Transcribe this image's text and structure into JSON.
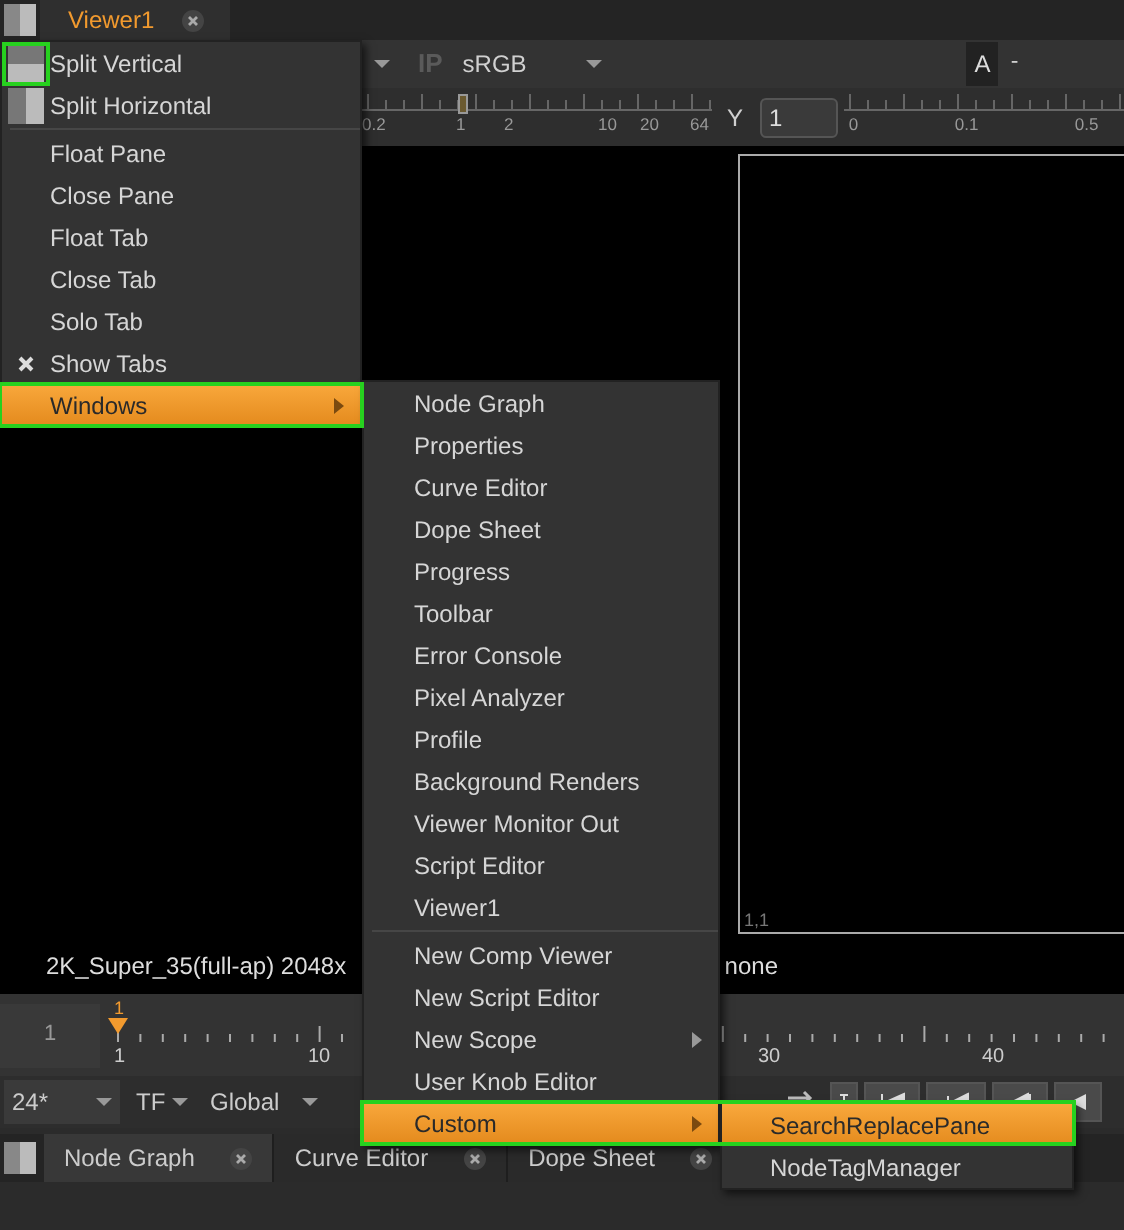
{
  "top_tabs": [
    {
      "label": "Viewer1",
      "selected": true
    }
  ],
  "viewer_toolbar": {
    "ip_button": {
      "label": "IP",
      "disabled": true
    },
    "colorspace": "sRGB",
    "input_label": "A",
    "input_value": "-"
  },
  "gain_ruler": {
    "labels": [
      "0.2",
      "1",
      "2",
      "10",
      "20",
      "64"
    ]
  },
  "gamma": {
    "label": "Y",
    "value": "1",
    "ruler_labels": [
      "0",
      "0.1",
      "0.5"
    ]
  },
  "viewer": {
    "corner_label": "1,1"
  },
  "info_bar": [
    "2K_Super_35(full-ap) 2048x",
    "none"
  ],
  "timeline": {
    "current_frame": "1",
    "marker_label": "1",
    "labels": [
      "1",
      "10",
      "30",
      "40"
    ]
  },
  "playback": {
    "fps": "24*",
    "time_format": "TF",
    "range": "Global"
  },
  "bottom_tabs": [
    {
      "label": "Node Graph",
      "selected": true
    },
    {
      "label": "Curve Editor",
      "selected": false
    },
    {
      "label": "Dope Sheet",
      "selected": false
    }
  ],
  "pane_menu": [
    {
      "label": "Split Vertical",
      "kind": "icon-split-v",
      "outlined": true,
      "highlighted": false,
      "checked": false,
      "submenu": false
    },
    {
      "label": "Split Horizontal",
      "kind": "icon-split-h",
      "outlined": false,
      "highlighted": false,
      "checked": false,
      "submenu": false
    },
    {
      "kind": "separator"
    },
    {
      "label": "Float Pane",
      "kind": "plain",
      "outlined": false,
      "highlighted": false,
      "checked": false,
      "submenu": false
    },
    {
      "label": "Close Pane",
      "kind": "plain",
      "outlined": false,
      "highlighted": false,
      "checked": false,
      "submenu": false
    },
    {
      "label": "Float Tab",
      "kind": "plain",
      "outlined": false,
      "highlighted": false,
      "checked": false,
      "submenu": false
    },
    {
      "label": "Close Tab",
      "kind": "plain",
      "outlined": false,
      "highlighted": false,
      "checked": false,
      "submenu": false
    },
    {
      "label": "Solo Tab",
      "kind": "plain",
      "outlined": false,
      "highlighted": false,
      "checked": false,
      "submenu": false
    },
    {
      "label": "Show Tabs",
      "kind": "plain",
      "outlined": false,
      "highlighted": false,
      "checked": true,
      "submenu": false
    },
    {
      "label": "Windows",
      "kind": "plain",
      "outlined": true,
      "highlighted": true,
      "checked": false,
      "submenu": true
    }
  ],
  "windows_menu": [
    {
      "label": "Node Graph",
      "kind": "plain",
      "highlighted": false,
      "outlined": false,
      "submenu": false
    },
    {
      "label": "Properties",
      "kind": "plain",
      "highlighted": false,
      "outlined": false,
      "submenu": false
    },
    {
      "label": "Curve Editor",
      "kind": "plain",
      "highlighted": false,
      "outlined": false,
      "submenu": false
    },
    {
      "label": "Dope Sheet",
      "kind": "plain",
      "highlighted": false,
      "outlined": false,
      "submenu": false
    },
    {
      "label": "Progress",
      "kind": "plain",
      "highlighted": false,
      "outlined": false,
      "submenu": false
    },
    {
      "label": "Toolbar",
      "kind": "plain",
      "highlighted": false,
      "outlined": false,
      "submenu": false
    },
    {
      "label": "Error Console",
      "kind": "plain",
      "highlighted": false,
      "outlined": false,
      "submenu": false
    },
    {
      "label": "Pixel Analyzer",
      "kind": "plain",
      "highlighted": false,
      "outlined": false,
      "submenu": false
    },
    {
      "label": "Profile",
      "kind": "plain",
      "highlighted": false,
      "outlined": false,
      "submenu": false
    },
    {
      "label": "Background Renders",
      "kind": "plain",
      "highlighted": false,
      "outlined": false,
      "submenu": false
    },
    {
      "label": "Viewer Monitor Out",
      "kind": "plain",
      "highlighted": false,
      "outlined": false,
      "submenu": false
    },
    {
      "label": "Script Editor",
      "kind": "plain",
      "highlighted": false,
      "outlined": false,
      "submenu": false
    },
    {
      "label": "Viewer1",
      "kind": "plain",
      "highlighted": false,
      "outlined": false,
      "submenu": false
    },
    {
      "kind": "separator"
    },
    {
      "label": "New Comp Viewer",
      "kind": "plain",
      "highlighted": false,
      "outlined": false,
      "submenu": false
    },
    {
      "label": "New Script Editor",
      "kind": "plain",
      "highlighted": false,
      "outlined": false,
      "submenu": false
    },
    {
      "label": "New Scope",
      "kind": "plain",
      "highlighted": false,
      "outlined": false,
      "submenu": true
    },
    {
      "label": "User Knob Editor",
      "kind": "plain",
      "highlighted": false,
      "outlined": false,
      "submenu": false
    },
    {
      "label": "Custom",
      "kind": "plain",
      "highlighted": true,
      "outlined": true,
      "submenu": true
    }
  ],
  "custom_menu": [
    {
      "label": "SearchReplacePane",
      "kind": "plain",
      "highlighted": true,
      "outlined": true,
      "submenu": false
    },
    {
      "label": "NodeTagManager",
      "kind": "plain",
      "highlighted": false,
      "outlined": false,
      "submenu": false
    }
  ]
}
